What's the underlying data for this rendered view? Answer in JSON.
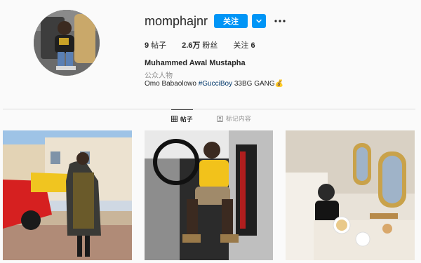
{
  "profile": {
    "username": "momphajnr",
    "follow_label": "关注",
    "full_name": "Muhammed Awal Mustapha",
    "category": "公众人物",
    "bio_prefix": "Omo Babaolowo ",
    "bio_hashtag": "#GucciBoy",
    "bio_suffix": " 33BG GANG💰"
  },
  "stats": {
    "posts_value": "9",
    "posts_label": "帖子",
    "followers_value": "2.6万",
    "followers_label": "粉丝",
    "following_label": "关注",
    "following_value": "6"
  },
  "tabs": {
    "posts": "帖子",
    "tagged": "标记内容"
  },
  "icons": {
    "avatar": "profile-photo",
    "follow_dropdown": "chevron-down-icon",
    "more": "more-options-icon",
    "posts_tab": "grid-icon",
    "tagged_tab": "tag-person-icon"
  },
  "colors": {
    "accent": "#0095f6",
    "text": "#262626",
    "muted": "#8e8e8e",
    "hashtag": "#00376b"
  }
}
